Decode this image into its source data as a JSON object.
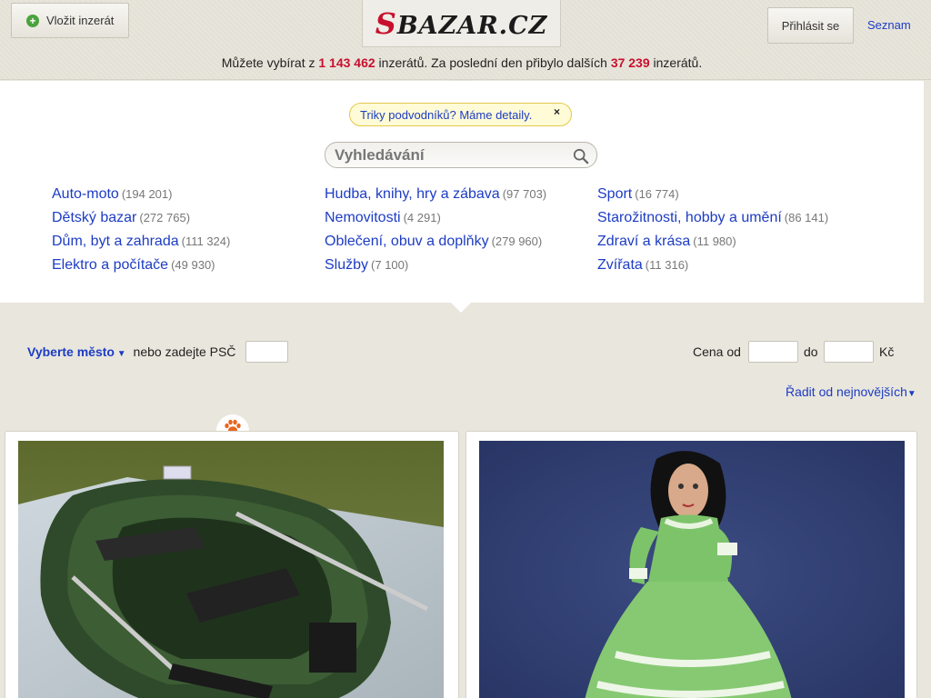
{
  "header": {
    "add_button": "Vložit inzerát",
    "logo_text": "BAZAR.CZ",
    "logo_initial": "S",
    "login_button": "Přihlásit se",
    "seznam_link": "Seznam",
    "stats": {
      "prefix": "Můžete vybírat z",
      "total": "1 143 462",
      "middle": "inzerátů. Za poslední den přibylo dalších",
      "new": "37 239",
      "suffix": "inzerátů."
    }
  },
  "tip": {
    "text": "Triky podvodníků? Máme detaily.",
    "close": "×"
  },
  "search": {
    "placeholder": "Vyhledávání"
  },
  "categories": [
    [
      {
        "label": "Auto-moto",
        "count": "(194 201)"
      },
      {
        "label": "Dětský bazar",
        "count": "(272 765)"
      },
      {
        "label": "Dům, byt a zahrada",
        "count": "(111 324)"
      },
      {
        "label": "Elektro a počítače",
        "count": "(49 930)"
      }
    ],
    [
      {
        "label": "Hudba, knihy, hry a zábava",
        "count": "(97 703)"
      },
      {
        "label": "Nemovitosti",
        "count": "(4 291)"
      },
      {
        "label": "Oblečení, obuv a doplňky",
        "count": "(279 960)"
      },
      {
        "label": "Služby",
        "count": "(7 100)"
      }
    ],
    [
      {
        "label": "Sport",
        "count": "(16 774)"
      },
      {
        "label": "Starožitnosti, hobby a umění",
        "count": "(86 141)"
      },
      {
        "label": "Zdraví a krása",
        "count": "(11 980)"
      },
      {
        "label": "Zvířata",
        "count": "(11 316)"
      }
    ]
  ],
  "filters": {
    "city_link": "Vyberte město",
    "psc_label": "nebo zadejte PSČ",
    "price_from_label": "Cena od",
    "price_to_label": "do",
    "currency": "Kč",
    "sort_link": "Řadit od nejnovějších"
  },
  "colors": {
    "accent_red": "#c8102e",
    "link_blue": "#1d3cc4",
    "paw_orange": "#e8651e"
  },
  "listings": [
    {
      "image": "inflatable-boat-photo"
    },
    {
      "image": "doll-green-dress-photo"
    }
  ]
}
